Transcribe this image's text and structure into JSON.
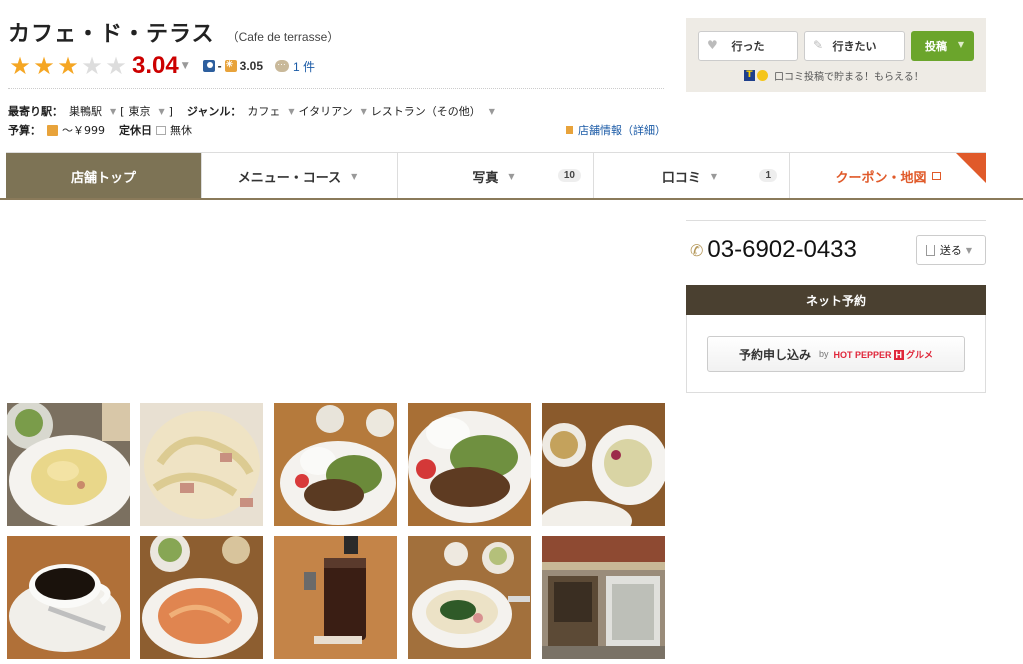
{
  "restaurant": {
    "name": "カフェ・ド・テラス",
    "name_romaji": "（Cafe de terrasse）",
    "score": "3.04",
    "dinner_score": "-",
    "lunch_score": "3.05",
    "review_count": "1 件",
    "stars_filled": 3,
    "stars_total": 5
  },
  "info": {
    "station_label": "最寄り駅：",
    "station": "巣鴨駅",
    "area_open": "[",
    "area": "東京",
    "area_close": "]",
    "genre_label": "ジャンル：",
    "genres": [
      "カフェ",
      "イタリアン",
      "レストラン（その他）"
    ],
    "budget_label": "予算：",
    "budget": "～￥999",
    "holiday_label": "定休日",
    "holiday": "無休",
    "detail_link": "店舗情報（詳細）"
  },
  "actions": {
    "went": "行った",
    "want": "行きたい",
    "post": "投稿",
    "promo": "口コミ投稿で貯まる！もらえる！"
  },
  "tabs": [
    {
      "label": "店舗トップ"
    },
    {
      "label": "メニュー・コース"
    },
    {
      "label": "写真",
      "count": "10"
    },
    {
      "label": "口コミ",
      "count": "1"
    },
    {
      "label": "クーポン・地図"
    }
  ],
  "contact": {
    "phone": "03-6902-0433",
    "send": "送る"
  },
  "reservation": {
    "header": "ネット予約",
    "button": "予約申し込み",
    "by": "by",
    "partner_a": "HOT PEPPER",
    "partner_h": "H",
    "partner_b": "グルメ"
  },
  "colors": {
    "score": "#cc0000",
    "tab_active": "#7d7355",
    "post_button": "#6ba52c",
    "coupon": "#e05a2a",
    "reserve_header": "#4a4030"
  },
  "photos": [
    {
      "name": "photo-carbonara-salad"
    },
    {
      "name": "photo-carbonara-closeup"
    },
    {
      "name": "photo-stirfry-plate"
    },
    {
      "name": "photo-stirfry-closeup"
    },
    {
      "name": "photo-salad-soup"
    },
    {
      "name": "photo-coffee"
    },
    {
      "name": "photo-tomato-pasta"
    },
    {
      "name": "photo-iced-coffee"
    },
    {
      "name": "photo-spinach-pasta"
    },
    {
      "name": "photo-storefront"
    }
  ]
}
